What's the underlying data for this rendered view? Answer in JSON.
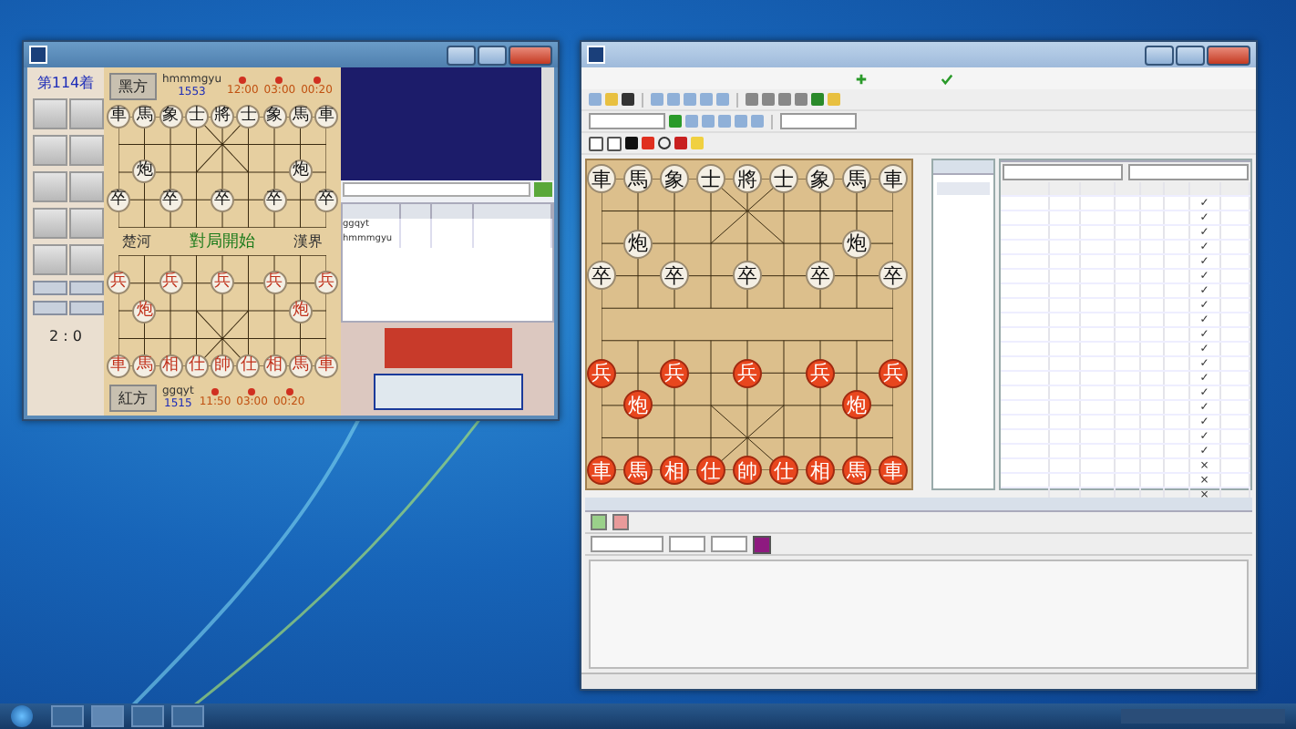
{
  "left_window": {
    "move_label": "第114着",
    "score": "2 : 0",
    "top_player": {
      "side_label": "黑方",
      "name": "hmmmgyu",
      "rating": "1553",
      "times": [
        "12:00",
        "03:00",
        "00:20"
      ]
    },
    "bottom_player": {
      "side_label": "紅方",
      "name": "ggqyt",
      "rating": "1515",
      "times": [
        "11:50",
        "03:00",
        "00:20"
      ]
    },
    "river": [
      "楚河",
      "對局開始",
      "漢界"
    ],
    "players_table": {
      "rows": [
        {
          "name": "ggqyt"
        },
        {
          "name": "hmmmgyu"
        }
      ]
    },
    "ranks": [
      [
        {
          "kind": "piece",
          "char": "車",
          "color": "#111111"
        },
        {
          "kind": "piece",
          "char": "馬",
          "color": "#111111"
        },
        {
          "kind": "piece",
          "char": "象",
          "color": "#111111"
        },
        {
          "kind": "piece",
          "char": "士",
          "color": "#111111"
        },
        {
          "kind": "piece",
          "char": "將",
          "color": "#111111"
        },
        {
          "kind": "piece",
          "char": "士",
          "color": "#111111"
        },
        {
          "kind": "piece",
          "char": "象",
          "color": "#111111"
        },
        {
          "kind": "piece",
          "char": "馬",
          "color": "#111111"
        },
        {
          "kind": "piece",
          "char": "車",
          "color": "#111111"
        }
      ],
      [
        {
          "kind": "point"
        },
        {
          "kind": "point"
        },
        {
          "kind": "point"
        },
        {
          "kind": "point"
        },
        {
          "kind": "point"
        },
        {
          "kind": "point"
        },
        {
          "kind": "point"
        },
        {
          "kind": "point"
        },
        {
          "kind": "point"
        }
      ],
      [
        {
          "kind": "point"
        },
        {
          "kind": "piece",
          "char": "炮",
          "color": "#111111"
        },
        {
          "kind": "point"
        },
        {
          "kind": "point"
        },
        {
          "kind": "point"
        },
        {
          "kind": "point"
        },
        {
          "kind": "point"
        },
        {
          "kind": "piece",
          "char": "炮",
          "color": "#111111"
        },
        {
          "kind": "point"
        }
      ],
      [
        {
          "kind": "piece",
          "char": "卒",
          "color": "#111111"
        },
        {
          "kind": "point"
        },
        {
          "kind": "piece",
          "char": "卒",
          "color": "#111111"
        },
        {
          "kind": "point"
        },
        {
          "kind": "piece",
          "char": "卒",
          "color": "#111111"
        },
        {
          "kind": "point"
        },
        {
          "kind": "piece",
          "char": "卒",
          "color": "#111111"
        },
        {
          "kind": "point"
        },
        {
          "kind": "piece",
          "char": "卒",
          "color": "#111111"
        }
      ],
      [
        {
          "kind": "point"
        },
        {
          "kind": "point"
        },
        {
          "kind": "point"
        },
        {
          "kind": "point"
        },
        {
          "kind": "point"
        },
        {
          "kind": "point"
        },
        {
          "kind": "point"
        },
        {
          "kind": "point"
        },
        {
          "kind": "point"
        }
      ],
      [
        {
          "kind": "point"
        },
        {
          "kind": "point"
        },
        {
          "kind": "point"
        },
        {
          "kind": "point"
        },
        {
          "kind": "point"
        },
        {
          "kind": "point"
        },
        {
          "kind": "point"
        },
        {
          "kind": "point"
        },
        {
          "kind": "point"
        }
      ],
      [
        {
          "kind": "piece",
          "char": "兵",
          "color": "#c0301a"
        },
        {
          "kind": "point"
        },
        {
          "kind": "piece",
          "char": "兵",
          "color": "#c0301a"
        },
        {
          "kind": "point"
        },
        {
          "kind": "piece",
          "char": "兵",
          "color": "#c0301a"
        },
        {
          "kind": "point"
        },
        {
          "kind": "piece",
          "char": "兵",
          "color": "#c0301a"
        },
        {
          "kind": "point"
        },
        {
          "kind": "piece",
          "char": "兵",
          "color": "#c0301a"
        }
      ],
      [
        {
          "kind": "point"
        },
        {
          "kind": "piece",
          "char": "炮",
          "color": "#c0301a"
        },
        {
          "kind": "point"
        },
        {
          "kind": "point"
        },
        {
          "kind": "point"
        },
        {
          "kind": "point"
        },
        {
          "kind": "point"
        },
        {
          "kind": "piece",
          "char": "炮",
          "color": "#c0301a"
        },
        {
          "kind": "point"
        }
      ],
      [
        {
          "kind": "point"
        },
        {
          "kind": "point"
        },
        {
          "kind": "point"
        },
        {
          "kind": "point"
        },
        {
          "kind": "point"
        },
        {
          "kind": "point"
        },
        {
          "kind": "point"
        },
        {
          "kind": "point"
        },
        {
          "kind": "point"
        }
      ],
      [
        {
          "kind": "piece",
          "char": "車",
          "color": "#c0301a"
        },
        {
          "kind": "piece",
          "char": "馬",
          "color": "#c0301a"
        },
        {
          "kind": "piece",
          "char": "相",
          "color": "#c0301a"
        },
        {
          "kind": "piece",
          "char": "仕",
          "color": "#c0301a"
        },
        {
          "kind": "piece",
          "char": "帥",
          "color": "#c0301a"
        },
        {
          "kind": "piece",
          "char": "仕",
          "color": "#c0301a"
        },
        {
          "kind": "piece",
          "char": "相",
          "color": "#c0301a"
        },
        {
          "kind": "piece",
          "char": "馬",
          "color": "#c0301a"
        },
        {
          "kind": "piece",
          "char": "車",
          "color": "#c0301a"
        }
      ]
    ]
  },
  "right_window": {
    "ranks": [
      [
        {
          "kind": "piece",
          "char": "車",
          "color": "#111111"
        },
        {
          "kind": "piece",
          "char": "馬",
          "color": "#111111"
        },
        {
          "kind": "piece",
          "char": "象",
          "color": "#111111"
        },
        {
          "kind": "piece",
          "char": "士",
          "color": "#111111"
        },
        {
          "kind": "piece",
          "char": "將",
          "color": "#111111"
        },
        {
          "kind": "piece",
          "char": "士",
          "color": "#111111"
        },
        {
          "kind": "piece",
          "char": "象",
          "color": "#111111"
        },
        {
          "kind": "piece",
          "char": "馬",
          "color": "#111111"
        },
        {
          "kind": "piece",
          "char": "車",
          "color": "#111111"
        }
      ],
      [
        {
          "kind": "point"
        },
        {
          "kind": "point"
        },
        {
          "kind": "point"
        },
        {
          "kind": "point"
        },
        {
          "kind": "point"
        },
        {
          "kind": "point"
        },
        {
          "kind": "point"
        },
        {
          "kind": "point"
        },
        {
          "kind": "point"
        }
      ],
      [
        {
          "kind": "point"
        },
        {
          "kind": "piece",
          "char": "炮",
          "color": "#111111"
        },
        {
          "kind": "point"
        },
        {
          "kind": "point"
        },
        {
          "kind": "point"
        },
        {
          "kind": "point"
        },
        {
          "kind": "point"
        },
        {
          "kind": "piece",
          "char": "炮",
          "color": "#111111"
        },
        {
          "kind": "point"
        }
      ],
      [
        {
          "kind": "piece",
          "char": "卒",
          "color": "#111111"
        },
        {
          "kind": "point"
        },
        {
          "kind": "piece",
          "char": "卒",
          "color": "#111111"
        },
        {
          "kind": "point"
        },
        {
          "kind": "piece",
          "char": "卒",
          "color": "#111111"
        },
        {
          "kind": "point"
        },
        {
          "kind": "piece",
          "char": "卒",
          "color": "#111111"
        },
        {
          "kind": "point"
        },
        {
          "kind": "piece",
          "char": "卒",
          "color": "#111111"
        }
      ],
      [
        {
          "kind": "point"
        },
        {
          "kind": "point"
        },
        {
          "kind": "point"
        },
        {
          "kind": "point"
        },
        {
          "kind": "point"
        },
        {
          "kind": "point"
        },
        {
          "kind": "point"
        },
        {
          "kind": "point"
        },
        {
          "kind": "point"
        }
      ],
      [
        {
          "kind": "point"
        },
        {
          "kind": "point"
        },
        {
          "kind": "point"
        },
        {
          "kind": "point"
        },
        {
          "kind": "point"
        },
        {
          "kind": "point"
        },
        {
          "kind": "point"
        },
        {
          "kind": "point"
        },
        {
          "kind": "point"
        }
      ],
      [
        {
          "kind": "piece",
          "char": "兵",
          "color": "#e8461e"
        },
        {
          "kind": "point"
        },
        {
          "kind": "piece",
          "char": "兵",
          "color": "#e8461e"
        },
        {
          "kind": "point"
        },
        {
          "kind": "piece",
          "char": "兵",
          "color": "#e8461e"
        },
        {
          "kind": "point"
        },
        {
          "kind": "piece",
          "char": "兵",
          "color": "#e8461e"
        },
        {
          "kind": "point"
        },
        {
          "kind": "piece",
          "char": "兵",
          "color": "#e8461e"
        }
      ],
      [
        {
          "kind": "point"
        },
        {
          "kind": "piece",
          "char": "炮",
          "color": "#e8461e"
        },
        {
          "kind": "point"
        },
        {
          "kind": "point"
        },
        {
          "kind": "point"
        },
        {
          "kind": "point"
        },
        {
          "kind": "point"
        },
        {
          "kind": "piece",
          "char": "炮",
          "color": "#e8461e"
        },
        {
          "kind": "point"
        }
      ],
      [
        {
          "kind": "point"
        },
        {
          "kind": "point"
        },
        {
          "kind": "point"
        },
        {
          "kind": "point"
        },
        {
          "kind": "point"
        },
        {
          "kind": "point"
        },
        {
          "kind": "point"
        },
        {
          "kind": "point"
        },
        {
          "kind": "point"
        }
      ],
      [
        {
          "kind": "piece",
          "char": "車",
          "color": "#e8461e"
        },
        {
          "kind": "piece",
          "char": "馬",
          "color": "#e8461e"
        },
        {
          "kind": "piece",
          "char": "相",
          "color": "#e8461e"
        },
        {
          "kind": "piece",
          "char": "仕",
          "color": "#e8461e"
        },
        {
          "kind": "piece",
          "char": "帥",
          "color": "#e8461e"
        },
        {
          "kind": "piece",
          "char": "仕",
          "color": "#e8461e"
        },
        {
          "kind": "piece",
          "char": "相",
          "color": "#e8461e"
        },
        {
          "kind": "piece",
          "char": "馬",
          "color": "#e8461e"
        },
        {
          "kind": "piece",
          "char": "車",
          "color": "#e8461e"
        }
      ]
    ],
    "engine_rows": [
      {
        "mark": "✓"
      },
      {
        "mark": "✓"
      },
      {
        "mark": "✓"
      },
      {
        "mark": "✓"
      },
      {
        "mark": "✓"
      },
      {
        "mark": "✓"
      },
      {
        "mark": "✓"
      },
      {
        "mark": "✓"
      },
      {
        "mark": "✓"
      },
      {
        "mark": "✓"
      },
      {
        "mark": "✓"
      },
      {
        "mark": "✓"
      },
      {
        "mark": "✓"
      },
      {
        "mark": "✓"
      },
      {
        "mark": "✓"
      },
      {
        "mark": "✓"
      },
      {
        "mark": "✓"
      },
      {
        "mark": "✓"
      },
      {
        "mark": "×"
      },
      {
        "mark": "×"
      },
      {
        "mark": "×"
      }
    ],
    "color_swatch": {
      "color": "#8e1a80"
    }
  }
}
